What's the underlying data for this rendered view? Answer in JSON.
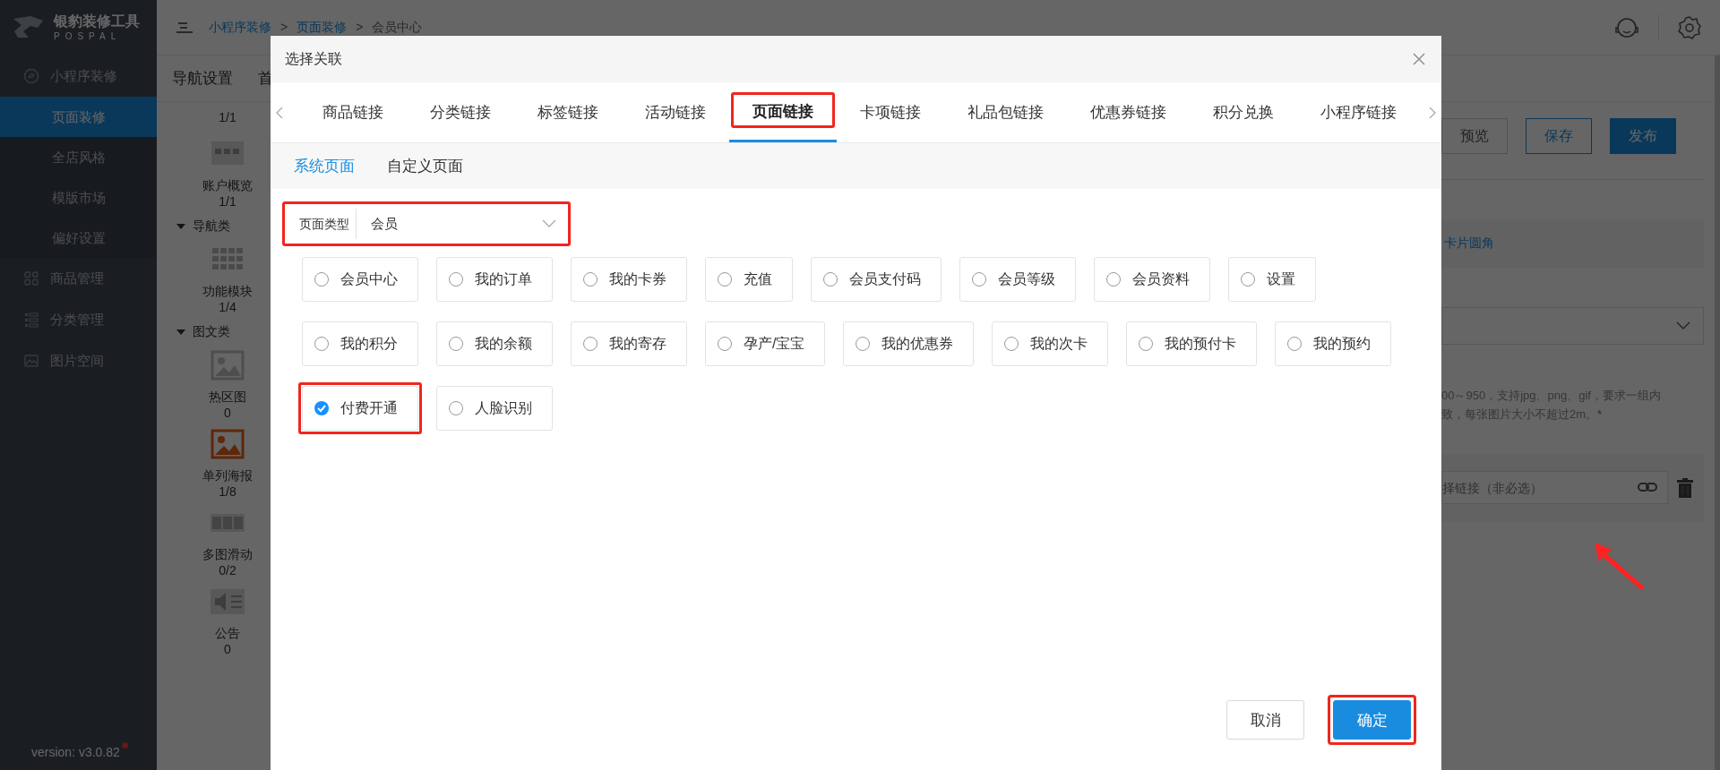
{
  "sidebar": {
    "logo_text": "银豹装修工具",
    "logo_subtext": "POSPAL",
    "menu": [
      {
        "label": "小程序装修",
        "expanded": true,
        "children": [
          {
            "label": "页面装修",
            "selected": true
          },
          {
            "label": "全店风格",
            "selected": false
          },
          {
            "label": "模版市场",
            "selected": false
          },
          {
            "label": "偏好设置",
            "selected": false
          }
        ]
      },
      {
        "label": "商品管理"
      },
      {
        "label": "分类管理"
      },
      {
        "label": "图片空间"
      }
    ],
    "version": "version: v3.0.82",
    "has_notification": true
  },
  "header": {
    "breadcrumb": [
      {
        "label": "小程序装修",
        "kind": "link"
      },
      {
        "label": ">",
        "kind": "separator"
      },
      {
        "label": "页面装修",
        "kind": "link"
      },
      {
        "label": ">",
        "kind": "separator"
      },
      {
        "label": "会员中心",
        "kind": "current"
      }
    ]
  },
  "subnav": [
    "导航设置",
    "首"
  ],
  "components": [
    {
      "kind": "count",
      "count": "1/1"
    },
    {
      "kind": "overview",
      "label": "账户概览",
      "count": "1/1",
      "selected": false
    },
    {
      "kind": "group",
      "label": "导航类",
      "expanded": true
    },
    {
      "kind": "modules",
      "label": "功能模块",
      "count": "1/4",
      "selected": false
    },
    {
      "kind": "group",
      "label": "图文类",
      "expanded": true
    },
    {
      "kind": "hotspot",
      "label": "热区图",
      "count": "0",
      "selected": false
    },
    {
      "kind": "poster",
      "label": "单列海报",
      "count": "1/8",
      "selected": true
    },
    {
      "kind": "slider",
      "label": "多图滑动",
      "count": "0/2",
      "selected": false
    },
    {
      "kind": "notice",
      "label": "公告",
      "count": "0",
      "selected": false
    }
  ],
  "settings": {
    "buttons": [
      {
        "label": "预览",
        "kind": "default"
      },
      {
        "label": "保存",
        "kind": "outline"
      },
      {
        "label": "发布",
        "kind": "primary"
      }
    ],
    "card_option": "卡片圆角",
    "hint_lines": [
      "00～950，支持jpg、png、gif，要求一组内",
      "致，每张图片大小不超过2m。"
    ],
    "required_mark": "*",
    "link_field": {
      "placeholder": "择链接（非必选）"
    }
  },
  "modal": {
    "title": "选择关联",
    "tabs": [
      {
        "label": "商品链接",
        "selected": false,
        "highlighted": false
      },
      {
        "label": "分类链接",
        "selected": false,
        "highlighted": false
      },
      {
        "label": "标签链接",
        "selected": false,
        "highlighted": false
      },
      {
        "label": "活动链接",
        "selected": false,
        "highlighted": false
      },
      {
        "label": "页面链接",
        "selected": true,
        "highlighted": true
      },
      {
        "label": "卡项链接",
        "selected": false,
        "highlighted": false
      },
      {
        "label": "礼品包链接",
        "selected": false,
        "highlighted": false
      },
      {
        "label": "优惠券链接",
        "selected": false,
        "highlighted": false
      },
      {
        "label": "积分兑换",
        "selected": false,
        "highlighted": false
      },
      {
        "label": "小程序链接",
        "selected": false,
        "highlighted": false
      }
    ],
    "subtabs": [
      {
        "label": "系统页面",
        "selected": true
      },
      {
        "label": "自定义页面",
        "selected": false
      }
    ],
    "filter": {
      "label": "页面类型",
      "value": "会员",
      "highlighted": true
    },
    "options": [
      {
        "label": "会员中心",
        "checked": false,
        "highlighted": false
      },
      {
        "label": "我的订单",
        "checked": false,
        "highlighted": false
      },
      {
        "label": "我的卡券",
        "checked": false,
        "highlighted": false
      },
      {
        "label": "充值",
        "checked": false,
        "highlighted": false
      },
      {
        "label": "会员支付码",
        "checked": false,
        "highlighted": false
      },
      {
        "label": "会员等级",
        "checked": false,
        "highlighted": false
      },
      {
        "label": "会员资料",
        "checked": false,
        "highlighted": false
      },
      {
        "label": "设置",
        "checked": false,
        "highlighted": false
      },
      {
        "label": "我的积分",
        "checked": false,
        "highlighted": false
      },
      {
        "label": "我的余额",
        "checked": false,
        "highlighted": false
      },
      {
        "label": "我的寄存",
        "checked": false,
        "highlighted": false
      },
      {
        "label": "孕产/宝宝",
        "checked": false,
        "highlighted": false
      },
      {
        "label": "我的优惠券",
        "checked": false,
        "highlighted": false
      },
      {
        "label": "我的次卡",
        "checked": false,
        "highlighted": false
      },
      {
        "label": "我的预付卡",
        "checked": false,
        "highlighted": false
      },
      {
        "label": "我的预约",
        "checked": false,
        "highlighted": false
      },
      {
        "label": "付费开通",
        "checked": true,
        "highlighted": true
      },
      {
        "label": "人脸识别",
        "checked": false,
        "highlighted": false
      }
    ],
    "buttons": [
      {
        "label": "取消",
        "kind": "default",
        "highlighted": false
      },
      {
        "label": "确定",
        "kind": "primary",
        "highlighted": true
      }
    ]
  },
  "annotations": [
    {
      "kind": "arrow"
    }
  ]
}
